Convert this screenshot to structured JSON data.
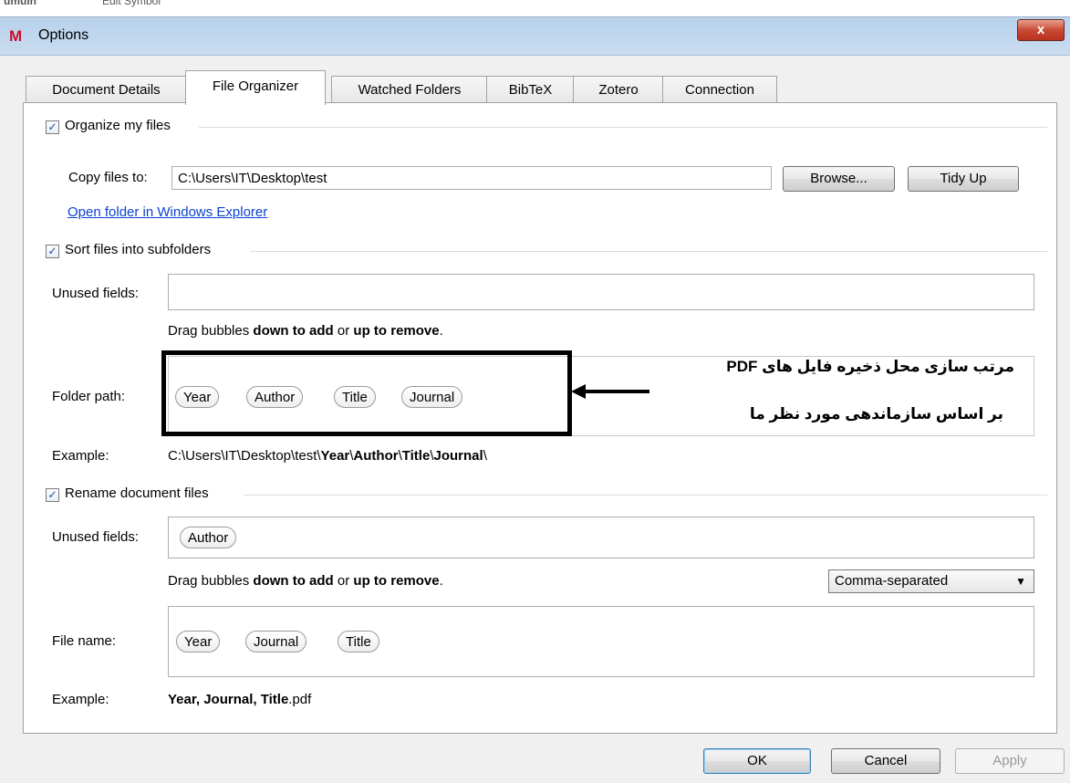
{
  "window": {
    "title": "Options",
    "app_logo": "M",
    "close_label": "x",
    "bg_strip_left": "umulh",
    "bg_strip_mid": "Edit Symbol"
  },
  "tabs": [
    {
      "label": "Document Details"
    },
    {
      "label": "File Organizer"
    },
    {
      "label": "Watched Folders"
    },
    {
      "label": "BibTeX"
    },
    {
      "label": "Zotero"
    },
    {
      "label": "Connection"
    }
  ],
  "organize": {
    "checkbox_label": "Organize my files",
    "checked": true,
    "copy_label": "Copy files to:",
    "copy_value": "C:\\Users\\IT\\Desktop\\test",
    "browse": "Browse...",
    "tidy_up": "Tidy Up",
    "open_folder_link": "Open folder in Windows Explorer"
  },
  "sort": {
    "checkbox_label": "Sort files into subfolders",
    "checked": true,
    "unused_label": "Unused fields:",
    "hint_prefix": "Drag bubbles ",
    "hint_down": "down to add",
    "hint_or": " or ",
    "hint_up": "up to remove",
    "hint_end": ".",
    "folder_path_label": "Folder path:",
    "folder_bubbles": [
      "Year",
      "Author",
      "Title",
      "Journal"
    ],
    "example_label": "Example:",
    "example_prefix": "C:\\Users\\IT\\Desktop\\test\\",
    "example_parts": [
      "Year",
      "Author",
      "Title",
      "Journal"
    ],
    "example_sep": "\\"
  },
  "rename": {
    "checkbox_label": "Rename document files",
    "checked": true,
    "unused_label": "Unused fields:",
    "unused_bubbles": [
      "Author"
    ],
    "hint_prefix": "Drag bubbles ",
    "hint_down": "down to add",
    "hint_or": " or ",
    "hint_up": "up to remove",
    "hint_end": ".",
    "separator_select": "Comma-separated",
    "file_name_label": "File name:",
    "file_bubbles": [
      "Year",
      "Journal",
      "Title"
    ],
    "example_label": "Example:",
    "example_bold": "Year, Journal, Title",
    "example_ext": ".pdf"
  },
  "annotation": {
    "line1": "مرتب سازی محل ذخیره فایل های PDF",
    "line2": "بر اساس سازماندهی مورد نظر ما"
  },
  "footer": {
    "ok": "OK",
    "cancel": "Cancel",
    "apply": "Apply"
  }
}
